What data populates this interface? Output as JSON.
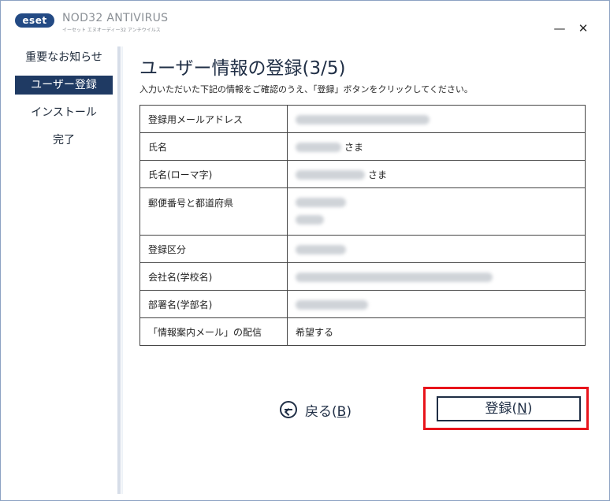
{
  "titlebar": {
    "logo": "eset",
    "product": "NOD32 ANTIVIRUS",
    "product_sub": "イーセット エヌオーディー32 アンチウイルス",
    "minimize_icon": "minimize-icon",
    "close_icon": "close-icon"
  },
  "sidebar": {
    "items": [
      {
        "label": "重要なお知らせ",
        "active": false
      },
      {
        "label": "ユーザー登録",
        "active": true
      },
      {
        "label": "インストール",
        "active": false
      },
      {
        "label": "完了",
        "active": false
      }
    ]
  },
  "main": {
    "title": "ユーザー情報の登録(3/5)",
    "subtitle": "入力いただいた下記の情報をご確認のうえ、「登録」ボタンをクリックしてください。",
    "rows": [
      {
        "label": "登録用メールアドレス",
        "value": "",
        "suffix": ""
      },
      {
        "label": "氏名",
        "value": "",
        "suffix": "さま"
      },
      {
        "label": "氏名(ローマ字)",
        "value": "",
        "suffix": "さま"
      },
      {
        "label": "郵便番号と都道府県",
        "value": "",
        "suffix": ""
      },
      {
        "label": "登録区分",
        "value": "",
        "suffix": ""
      },
      {
        "label": "会社名(学校名)",
        "value": "",
        "suffix": ""
      },
      {
        "label": "部署名(学部名)",
        "value": "",
        "suffix": ""
      },
      {
        "label": "「情報案内メール」の配信",
        "value": "希望する",
        "suffix": ""
      }
    ]
  },
  "buttons": {
    "back_text": "戻る(",
    "back_key": "B",
    "back_close": ")",
    "register_text": "登録(",
    "register_key": "N",
    "register_close": ")"
  },
  "colors": {
    "accent": "#1f3a63",
    "highlight": "#e8141b"
  }
}
